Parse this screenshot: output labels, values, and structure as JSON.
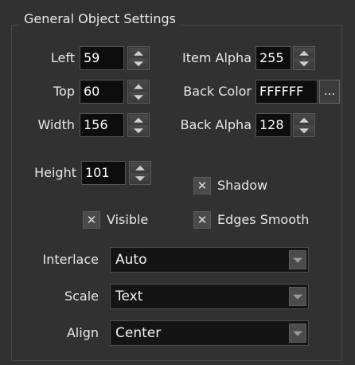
{
  "group": {
    "title": "General Object Settings"
  },
  "fields": {
    "left": {
      "label": "Left",
      "value": "59"
    },
    "top": {
      "label": "Top",
      "value": "60"
    },
    "width": {
      "label": "Width",
      "value": "156"
    },
    "height": {
      "label": "Height",
      "value": "101"
    },
    "item_alpha": {
      "label": "Item Alpha",
      "value": "255"
    },
    "back_color": {
      "label": "Back Color",
      "value": "FFFFFF",
      "button": "..."
    },
    "back_alpha": {
      "label": "Back Alpha",
      "value": "128"
    }
  },
  "checkboxes": {
    "shadow": {
      "label": "Shadow",
      "checked": true,
      "mark": "✕"
    },
    "visible": {
      "label": "Visible",
      "checked": true,
      "mark": "✕"
    },
    "edges_smooth": {
      "label": "Edges Smooth",
      "checked": true,
      "mark": "✕"
    }
  },
  "selects": {
    "interlace": {
      "label": "Interlace",
      "value": "Auto"
    },
    "scale": {
      "label": "Scale",
      "value": "Text"
    },
    "align": {
      "label": "Align",
      "value": "Center"
    }
  }
}
